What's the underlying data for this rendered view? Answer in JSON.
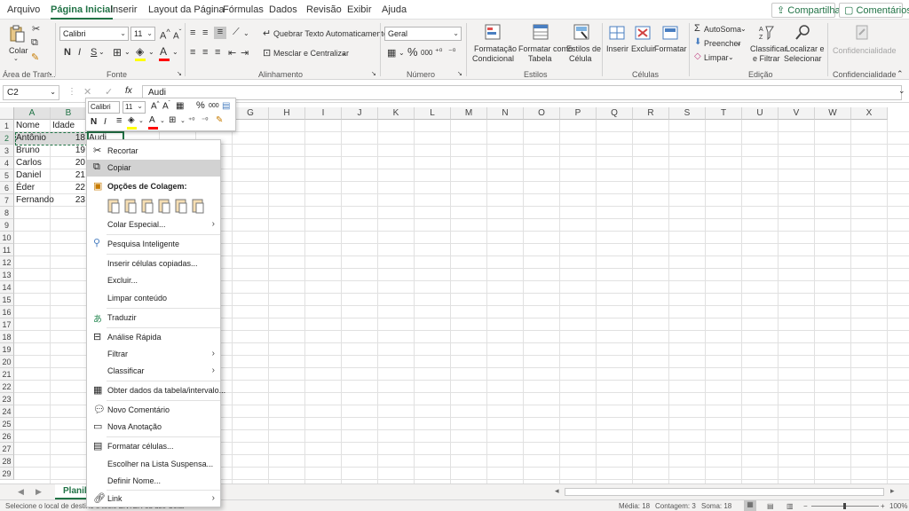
{
  "menu": {
    "tabs": [
      "Arquivo",
      "Página Inicial",
      "Inserir",
      "Layout da Página",
      "Fórmulas",
      "Dados",
      "Revisão",
      "Exibir",
      "Ajuda"
    ],
    "active_tab": "Página Inicial",
    "share_label": "Compartilhar",
    "comments_label": "Comentários"
  },
  "ribbon": {
    "clipboard": {
      "paste_label": "Colar",
      "group_label": "Área de Tran..."
    },
    "font": {
      "font_name": "Calibri",
      "font_size": "11",
      "group_label": "Fonte",
      "bold": "N",
      "italic": "I",
      "underline": "S"
    },
    "alignment": {
      "wrap_text": "Quebrar Texto Automaticamente",
      "merge_center": "Mesclar e Centralizar",
      "group_label": "Alinhamento"
    },
    "number": {
      "format": "Geral",
      "group_label": "Número",
      "percent": "%",
      "thousands": "000"
    },
    "styles": {
      "conditional_1": "Formatação",
      "conditional_2": "Condicional",
      "table_1": "Formatar como",
      "table_2": "Tabela",
      "cell_1": "Estilos de",
      "cell_2": "Célula",
      "group_label": "Estilos"
    },
    "cells": {
      "insert": "Inserir",
      "delete": "Excluir",
      "format": "Formatar",
      "group_label": "Células"
    },
    "editing": {
      "autosum": "AutoSoma",
      "fill": "Preencher",
      "clear": "Limpar",
      "sort_1": "Classificar",
      "sort_2": "e Filtrar",
      "find_1": "Localizar e",
      "find_2": "Selecionar",
      "group_label": "Edição"
    },
    "sensitivity": {
      "label": "Confidencialidade",
      "group_label": "Confidencialidade"
    }
  },
  "formula_bar": {
    "name_box": "C2",
    "fx": "fx",
    "content": "Audi"
  },
  "grid": {
    "columns": [
      "A",
      "B",
      "C",
      "D",
      "E",
      "F",
      "G",
      "H",
      "I",
      "J",
      "K",
      "L",
      "M",
      "N",
      "O",
      "P",
      "Q",
      "R",
      "S",
      "T",
      "U",
      "V",
      "W",
      "X"
    ],
    "rows": [
      "1",
      "2",
      "3",
      "4",
      "5",
      "6",
      "7",
      "8",
      "9",
      "10",
      "11",
      "12",
      "13",
      "14",
      "15",
      "16",
      "17",
      "18",
      "19",
      "20",
      "21",
      "22",
      "23",
      "24",
      "25",
      "26",
      "27",
      "28",
      "29"
    ],
    "cells": {
      "A1": "Nome",
      "B1": "Idade",
      "A2": "Antônio",
      "B2": "18",
      "C2": "Audi",
      "A3": "Bruno",
      "B3": "19",
      "A4": "Carlos",
      "B4": "20",
      "A5": "Daniel",
      "B5": "21",
      "A6": "Éder",
      "B6": "22",
      "A7": "Fernando",
      "B7": "23"
    }
  },
  "mini_toolbar": {
    "font": "Calibri",
    "size": "11",
    "bold": "N",
    "italic": "I",
    "percent": "%",
    "thousands": "000"
  },
  "context_menu": {
    "items": [
      {
        "label": "Recortar",
        "icon": "scissors-icon"
      },
      {
        "label": "Copiar",
        "icon": "copy-icon"
      },
      {
        "label": "Opções de Colagem:",
        "icon": "paste-icon"
      },
      {
        "label": "Colar Especial...",
        "icon": ""
      },
      {
        "label": "Pesquisa Inteligente",
        "icon": "search-icon"
      },
      {
        "label": "Inserir células copiadas...",
        "icon": ""
      },
      {
        "label": "Excluir...",
        "icon": ""
      },
      {
        "label": "Limpar conteúdo",
        "icon": ""
      },
      {
        "label": "Traduzir",
        "icon": "translate-icon"
      },
      {
        "label": "Análise Rápida",
        "icon": "quick-analysis-icon"
      },
      {
        "label": "Filtrar",
        "icon": ""
      },
      {
        "label": "Classificar",
        "icon": ""
      },
      {
        "label": "Obter dados da tabela/intervalo...",
        "icon": "table-icon"
      },
      {
        "label": "Novo Comentário",
        "icon": "comment-icon"
      },
      {
        "label": "Nova Anotação",
        "icon": "note-icon"
      },
      {
        "label": "Formatar células...",
        "icon": "format-cells-icon"
      },
      {
        "label": "Escolher na Lista Suspensa...",
        "icon": ""
      },
      {
        "label": "Definir Nome...",
        "icon": ""
      },
      {
        "label": "Link",
        "icon": "link-icon"
      }
    ]
  },
  "sheet_tab": "Planilha1",
  "status": {
    "message": "Selecione o local de destino e tecle ENTER ou use Colar",
    "average": "Média: 18",
    "count": "Contagem: 3",
    "sum": "Soma: 18",
    "zoom": "100%"
  },
  "colors": {
    "accent": "#217346",
    "selection": "#217346",
    "menu_highlight": "#d2d2d2"
  }
}
